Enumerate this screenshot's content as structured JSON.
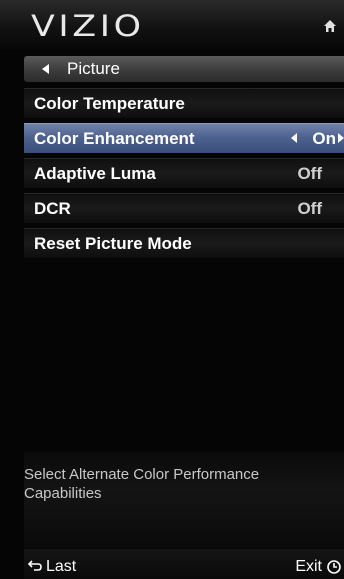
{
  "header": {
    "logo": "VIZIO",
    "home_icon": "home-icon"
  },
  "breadcrumb": {
    "label": "Picture",
    "icon": "back-arrow-icon"
  },
  "menu": {
    "items": [
      {
        "label": "Color Temperature",
        "value": ""
      },
      {
        "label": "Color Enhancement",
        "value": "On"
      },
      {
        "label": "Adaptive Luma",
        "value": "Off"
      },
      {
        "label": "DCR",
        "value": "Off"
      },
      {
        "label": "Reset Picture Mode",
        "value": ""
      }
    ],
    "selected_index": 1
  },
  "description": "Select Alternate Color Performance Capabilities",
  "footer": {
    "last_label": "Last",
    "exit_label": "Exit"
  },
  "colors": {
    "selected_row": "#4e6290",
    "background": "#050505",
    "text": "#ffffff"
  }
}
